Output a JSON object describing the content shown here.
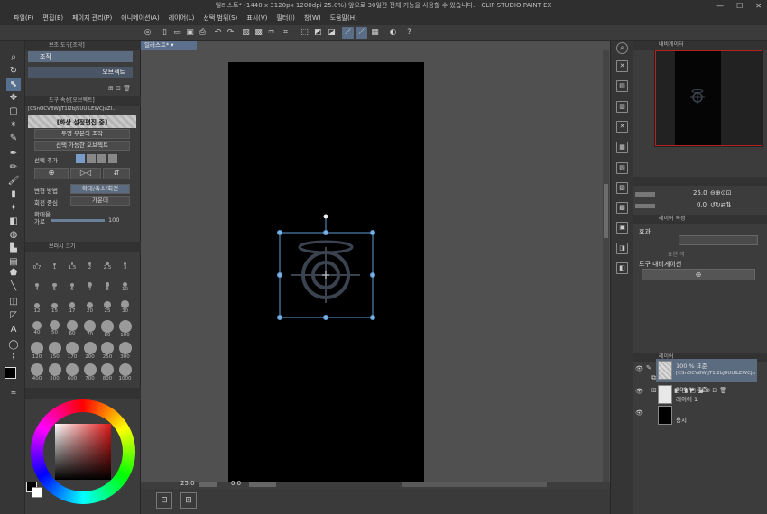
{
  "title_bar": {
    "text": "일러스트* (1440 x 3120px 1200dpi 25.0%)  앞으로 30일간 전체 기능을 사용할 수 있습니다. - CLIP STUDIO PAINT EX",
    "minimize": "—",
    "maximize": "☐",
    "close": "✕"
  },
  "menu": [
    "파일(F)",
    "편집(E)",
    "페이지 관리(P)",
    "애니메이션(A)",
    "레이어(L)",
    "선택 범위(S)",
    "표시(V)",
    "필터(I)",
    "창(W)",
    "도움말(H)"
  ],
  "sub_tool_panel": {
    "title": "보조 도구[조작]",
    "items": [
      "조작",
      "오브젝트"
    ]
  },
  "tool_property_panel": {
    "title": "도구 속성[오브젝트]",
    "file_name": "[CSnOCV8WjjT1l2bJ9UUlLEWCjuZI..."
  },
  "object_panel": {
    "edit_label": "[화상 설정편집 중]",
    "transparent_op": "투명 부분의 조작",
    "selectable": "선택 가능한 오브젝트",
    "select_add_label": "선택 추가",
    "transform_method_label": "변형 방법",
    "transform_method_value": "확대/축소/회전",
    "rotation_center_label": "회전 중심",
    "rotation_center_value": "가운데",
    "scale_label": "확대율",
    "horizontal_label": "가로",
    "horizontal_value": "100"
  },
  "brush_panel": {
    "title": "브러시 크기",
    "sizes": [
      "0.7",
      "1",
      "1.5",
      "2",
      "2.5",
      "3",
      "4",
      "5",
      "6",
      "7",
      "8",
      "10",
      "12",
      "15",
      "17",
      "20",
      "25",
      "30",
      "40",
      "50",
      "60",
      "70",
      "80",
      "100",
      "120",
      "150",
      "170",
      "200",
      "250",
      "300",
      "400",
      "500",
      "600",
      "700",
      "800",
      "1000"
    ]
  },
  "document_tab": "일러스트*",
  "status_bar": {
    "zoom": "25.0",
    "rotation": "0.0"
  },
  "navigator": {
    "title": "내비게이터",
    "zoom": "25.0",
    "rotation": "0.0"
  },
  "layer_property": {
    "title": "레이어 속성",
    "effect_label": "효과",
    "expression_color_label": "표현 색",
    "tool_navigation": "도구 내비게이션"
  },
  "layers_panel": {
    "title": "레이어",
    "blend_mode": "표준",
    "opacity": "100",
    "layers": [
      {
        "name_line1": "100 % 표준",
        "name_line2": "[CSnOCV8WjjT1l2bJ9UUlLEWCjuZ..."
      },
      {
        "name_line1": "100 % 표준",
        "name_line2": "레이어 1"
      },
      {
        "name_line1": "",
        "name_line2": "용지"
      }
    ]
  },
  "colors": {
    "accent": "#5a6e88",
    "selection": "#5b9bd5",
    "navigator_frame": "#b52020"
  }
}
